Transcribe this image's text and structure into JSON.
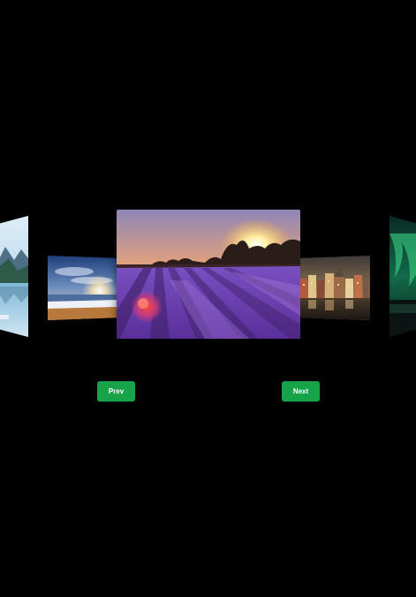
{
  "carousel": {
    "slides": [
      {
        "id": "mountain-lake",
        "position": "far-left"
      },
      {
        "id": "sunset-beach",
        "position": "left"
      },
      {
        "id": "lavender-field-sunset",
        "position": "center",
        "active": true
      },
      {
        "id": "harbor-town-evening",
        "position": "right"
      },
      {
        "id": "aurora-night",
        "position": "far-right"
      }
    ]
  },
  "controls": {
    "prev_label": "Prev",
    "next_label": "Next",
    "button_color": "#16a349"
  },
  "colors": {
    "background": "#000000"
  }
}
